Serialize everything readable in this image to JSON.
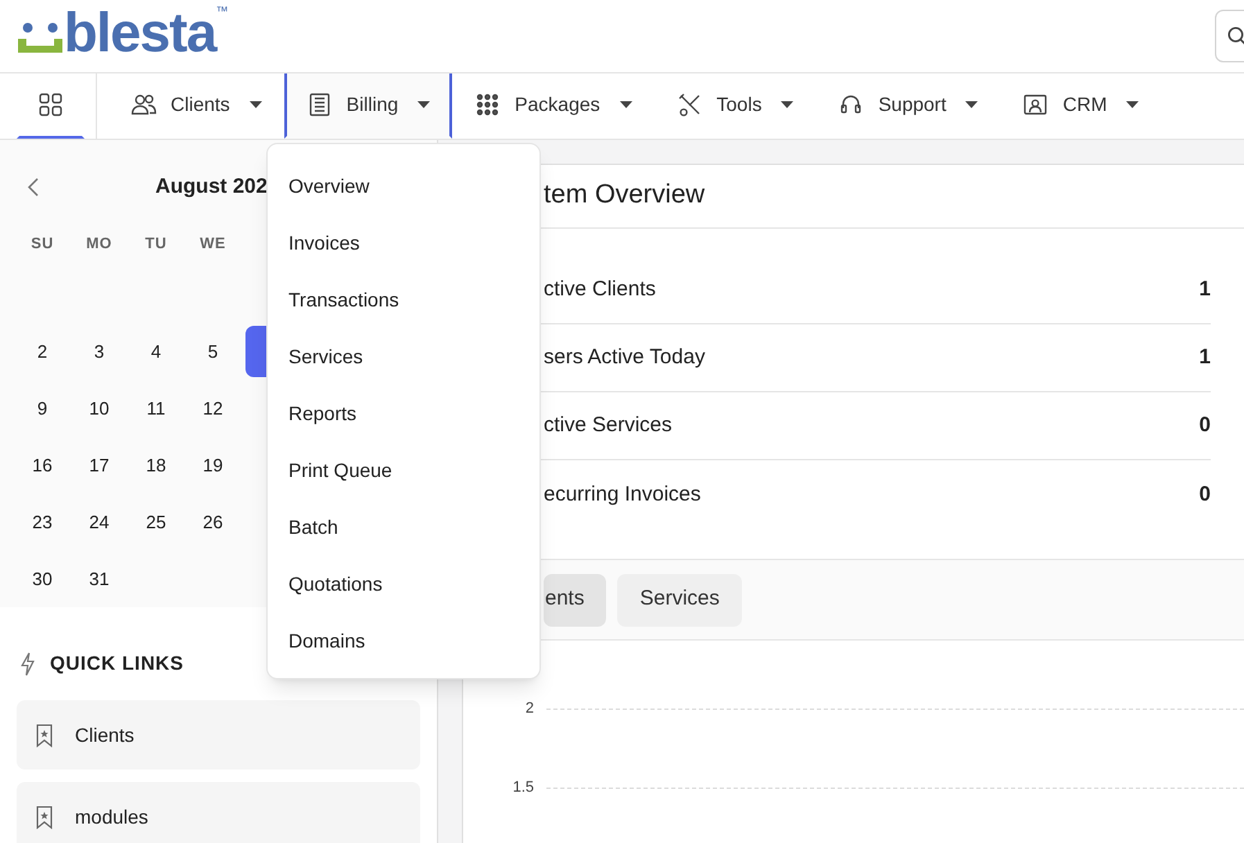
{
  "logo": {
    "text": "blesta",
    "mark": "™"
  },
  "nav": [
    {
      "kind": "dashboard",
      "selected": true,
      "expanded": false
    },
    {
      "kind": "clients",
      "label": "Clients",
      "selected": false,
      "expanded": false
    },
    {
      "kind": "billing",
      "label": "Billing",
      "selected": false,
      "expanded": true
    },
    {
      "kind": "packages",
      "label": "Packages",
      "selected": false,
      "expanded": false
    },
    {
      "kind": "tools",
      "label": "Tools",
      "selected": false,
      "expanded": false
    },
    {
      "kind": "support",
      "label": "Support",
      "selected": false,
      "expanded": false
    },
    {
      "kind": "crm",
      "label": "CRM",
      "selected": false,
      "expanded": false
    }
  ],
  "billing_menu": [
    "Overview",
    "Invoices",
    "Transactions",
    "Services",
    "Reports",
    "Print Queue",
    "Batch",
    "Quotations",
    "Domains"
  ],
  "calendar": {
    "month": "August 202",
    "weekdays": [
      "SU",
      "MO",
      "TU",
      "WE"
    ],
    "weeks": [
      [
        {
          "day": "2",
          "selected": false
        },
        {
          "day": "3",
          "selected": false
        },
        {
          "day": "4",
          "selected": false
        },
        {
          "day": "5",
          "selected": false
        },
        {
          "selected": true
        }
      ],
      [
        {
          "day": "9",
          "selected": false
        },
        {
          "day": "10",
          "selected": false
        },
        {
          "day": "11",
          "selected": false
        },
        {
          "day": "12",
          "selected": false
        }
      ],
      [
        {
          "day": "16",
          "selected": false
        },
        {
          "day": "17",
          "selected": false
        },
        {
          "day": "18",
          "selected": false
        },
        {
          "day": "19",
          "selected": false
        }
      ],
      [
        {
          "day": "23",
          "selected": false
        },
        {
          "day": "24",
          "selected": false
        },
        {
          "day": "25",
          "selected": false
        },
        {
          "day": "26",
          "selected": false
        }
      ],
      [
        {
          "day": "30",
          "selected": false
        },
        {
          "day": "31",
          "selected": false
        }
      ]
    ]
  },
  "quick_links": {
    "title": "QUICK LINKS",
    "items": [
      "Clients",
      "modules"
    ]
  },
  "overview": {
    "title": "tem Overview",
    "stats": [
      {
        "label": "ctive Clients",
        "value": "1"
      },
      {
        "label": "sers Active Today",
        "value": "1"
      },
      {
        "label": "ctive Services",
        "value": "0"
      },
      {
        "label": "ecurring Invoices",
        "value": "0"
      }
    ],
    "tabs": [
      {
        "label": "ents",
        "selected": true
      },
      {
        "label": "Services",
        "selected": false
      }
    ],
    "chart": {
      "y_labels": [
        "2",
        "1.5"
      ]
    }
  }
}
